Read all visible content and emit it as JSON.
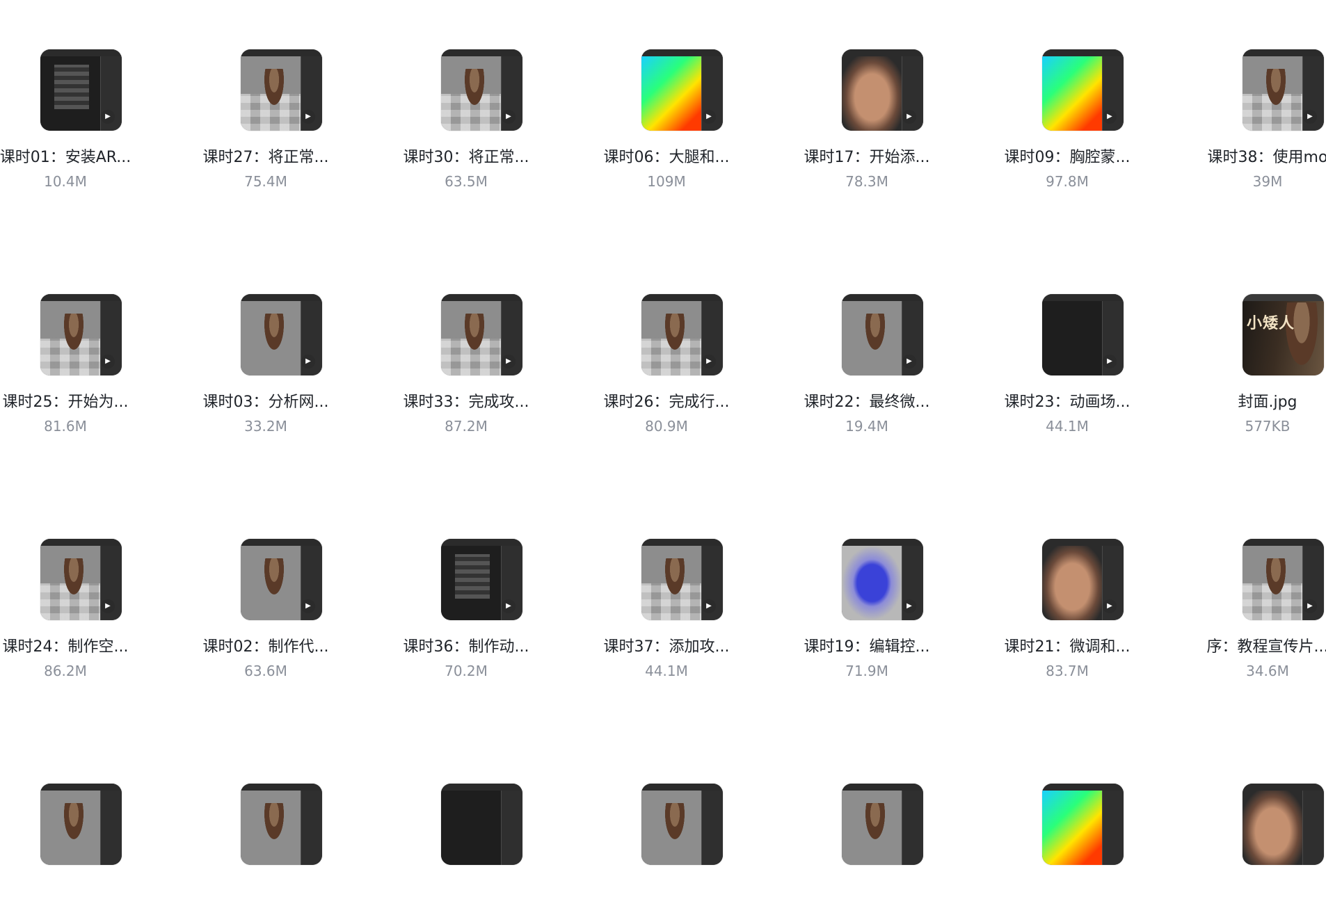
{
  "files": [
    {
      "name": "课时01：安装AR...",
      "size": "10.4M",
      "kind": "video"
    },
    {
      "name": "课时27：将正常...",
      "size": "75.4M",
      "kind": "video"
    },
    {
      "name": "课时30：将正常...",
      "size": "63.5M",
      "kind": "video"
    },
    {
      "name": "课时06：大腿和...",
      "size": "109M",
      "kind": "video"
    },
    {
      "name": "课时17：开始添...",
      "size": "78.3M",
      "kind": "video"
    },
    {
      "name": "课时09：胸腔蒙...",
      "size": "97.8M",
      "kind": "video"
    },
    {
      "name": "课时38：使用mo",
      "size": "39M",
      "kind": "video"
    },
    {
      "name": "课时25：开始为...",
      "size": "81.6M",
      "kind": "video"
    },
    {
      "name": "课时03：分析网...",
      "size": "33.2M",
      "kind": "video"
    },
    {
      "name": "课时33：完成攻...",
      "size": "87.2M",
      "kind": "video"
    },
    {
      "name": "课时26：完成行...",
      "size": "80.9M",
      "kind": "video"
    },
    {
      "name": "课时22：最终微...",
      "size": "19.4M",
      "kind": "video"
    },
    {
      "name": "课时23：动画场...",
      "size": "44.1M",
      "kind": "video"
    },
    {
      "name": "封面.jpg",
      "size": "577KB",
      "kind": "image",
      "cover_text": "小矮人"
    },
    {
      "name": "课时24：制作空...",
      "size": "86.2M",
      "kind": "video"
    },
    {
      "name": "课时02：制作代...",
      "size": "63.6M",
      "kind": "video"
    },
    {
      "name": "课时36：制作动...",
      "size": "70.2M",
      "kind": "video"
    },
    {
      "name": "课时37：添加攻...",
      "size": "44.1M",
      "kind": "video"
    },
    {
      "name": "课时19：编辑控...",
      "size": "71.9M",
      "kind": "video"
    },
    {
      "name": "课时21：微调和...",
      "size": "83.7M",
      "kind": "video"
    },
    {
      "name": "序：教程宣传片...",
      "size": "34.6M",
      "kind": "video"
    },
    {
      "name": "",
      "size": "",
      "kind": "video"
    },
    {
      "name": "",
      "size": "",
      "kind": "video"
    },
    {
      "name": "",
      "size": "",
      "kind": "video"
    },
    {
      "name": "",
      "size": "",
      "kind": "video"
    },
    {
      "name": "",
      "size": "",
      "kind": "video"
    },
    {
      "name": "",
      "size": "",
      "kind": "video"
    },
    {
      "name": "",
      "size": "",
      "kind": "video"
    }
  ],
  "icons": {
    "play": "play-icon"
  }
}
